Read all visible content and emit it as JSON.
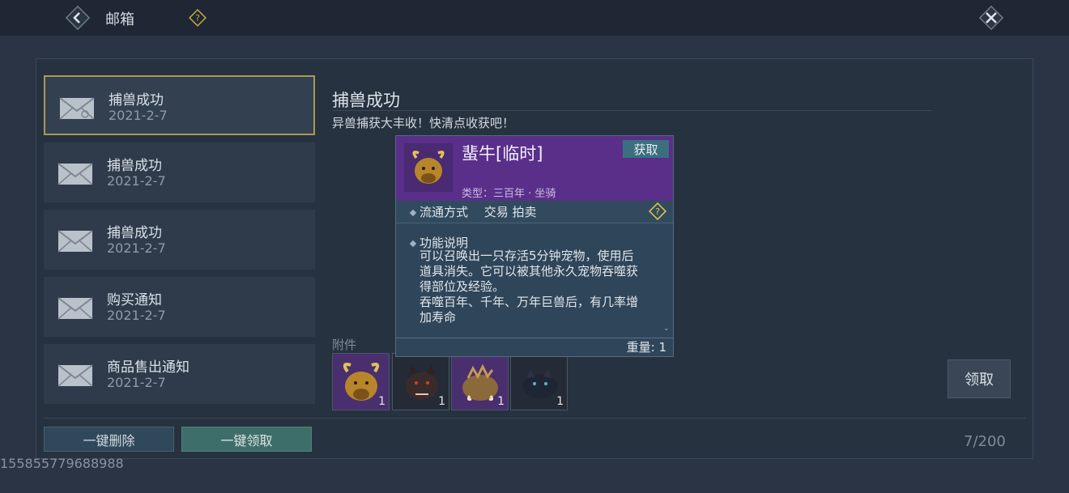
{
  "header": {
    "title": "邮箱"
  },
  "mail_list": [
    {
      "title": "捕兽成功",
      "date": "2021-2-7",
      "selected": true
    },
    {
      "title": "捕兽成功",
      "date": "2021-2-7",
      "selected": false
    },
    {
      "title": "捕兽成功",
      "date": "2021-2-7",
      "selected": false
    },
    {
      "title": "购买通知",
      "date": "2021-2-7",
      "selected": false
    },
    {
      "title": "商品售出通知",
      "date": "2021-2-7",
      "selected": false
    }
  ],
  "detail": {
    "title": "捕兽成功",
    "body": "异兽捕获大丰收！快清点收获吧！",
    "attachments_label": "附件",
    "attachments": [
      {
        "icon": "bull-mount-icon",
        "count": "1",
        "rarity": "purple"
      },
      {
        "icon": "wolf-pet-icon",
        "count": "1",
        "rarity": "common"
      },
      {
        "icon": "boar-mount-icon",
        "count": "1",
        "rarity": "purple"
      },
      {
        "icon": "panther-pet-icon",
        "count": "1",
        "rarity": "common"
      }
    ],
    "claim_label": "领取"
  },
  "tooltip": {
    "name": "蜚牛[临时]",
    "get_label": "获取",
    "type": "类型：三百年 · 坐骑",
    "circulation": "流通方式　 交易 拍卖",
    "func_title": "功能说明",
    "func_lines": [
      "可以召唤出一只存活5分钟宠物，使用后",
      "道具消失。它可以被其他永久宠物吞噬获",
      "得部位及经验。",
      "吞噬百年、千年、万年巨兽后，有几率增",
      "加寿命"
    ],
    "weight": "重量: 1"
  },
  "footer": {
    "delete_all": "一键删除",
    "claim_all": "一键领取",
    "count": "7/200"
  },
  "user_id": "155855779688988",
  "colors": {
    "selected_border": "#a89a54",
    "rarity_purple": "#5a2f8a",
    "claim_all_bg": "#3d6e6a"
  }
}
